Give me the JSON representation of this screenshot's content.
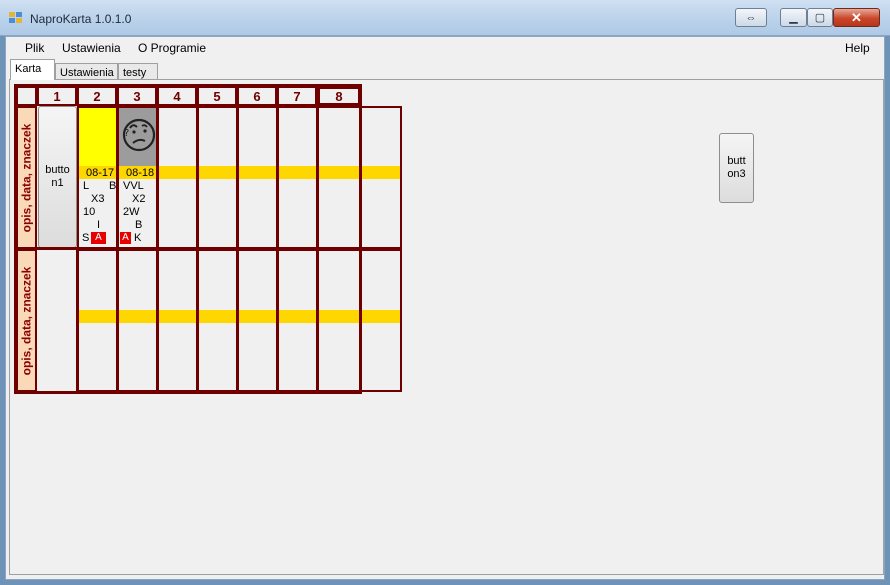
{
  "window": {
    "title": "NaproKarta 1.0.1.0",
    "restore_icon": "restore-icon",
    "minimize_icon": "minimize-icon",
    "maximize_icon": "maximize-icon",
    "close_icon": "close-icon"
  },
  "menu": {
    "plik": "Plik",
    "ustawienia": "Ustawienia",
    "o_programie": "O Programie",
    "help": "Help"
  },
  "tabs": [
    {
      "label": "Karta"
    },
    {
      "label": "Ustawienia"
    },
    {
      "label": "testy"
    }
  ],
  "grid": {
    "column_headers": [
      "1",
      "2",
      "3",
      "4",
      "5",
      "6",
      "7",
      "8"
    ],
    "row_labels": [
      "opis, data, znaczek",
      "opis, data, znaczek"
    ],
    "button1": "butto\nn1",
    "cells": {
      "c2": {
        "date": "08-17",
        "l1_left": "L",
        "l1_right": "B",
        "l2": "X3",
        "l3": "10",
        "l4": "I",
        "l5_left": "S",
        "l5_box": "A",
        "top_color": "#ffff00"
      },
      "c3": {
        "date": "08-18",
        "l1": "VVL",
        "l2": "X2",
        "l3": "2W",
        "l4": "B",
        "l5_box": "A",
        "l5_right": "K",
        "top_color": "#9c9c9c",
        "icon": "confused-face-icon"
      }
    }
  },
  "button3": "butt\non3",
  "colors": {
    "accent_maroon": "#700000",
    "strip_yellow": "#ffd700",
    "label_peach": "#f9d9b8",
    "marker_red": "#e60000"
  }
}
